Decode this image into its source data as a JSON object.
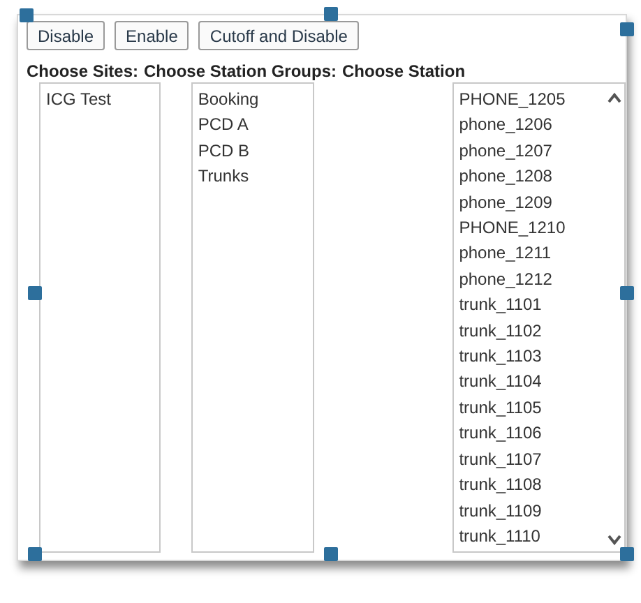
{
  "buttons": [
    {
      "label": "Disable"
    },
    {
      "label": "Enable"
    },
    {
      "label": "Cutoff and Disable"
    }
  ],
  "headings": [
    "Choose Sites:",
    "Choose Station Groups:",
    "Choose Station"
  ],
  "sites": [
    "ICG Test"
  ],
  "station_groups": [
    "Booking",
    "PCD A",
    "PCD B",
    "Trunks"
  ],
  "stations": [
    "PHONE_1205",
    "phone_1206",
    "phone_1207",
    "phone_1208",
    "phone_1209",
    "PHONE_1210",
    "phone_1211",
    "phone_1212",
    "trunk_1101",
    "trunk_1102",
    "trunk_1103",
    "trunk_1104",
    "trunk_1105",
    "trunk_1106",
    "trunk_1107",
    "trunk_1108",
    "trunk_1109",
    "trunk_1110"
  ]
}
